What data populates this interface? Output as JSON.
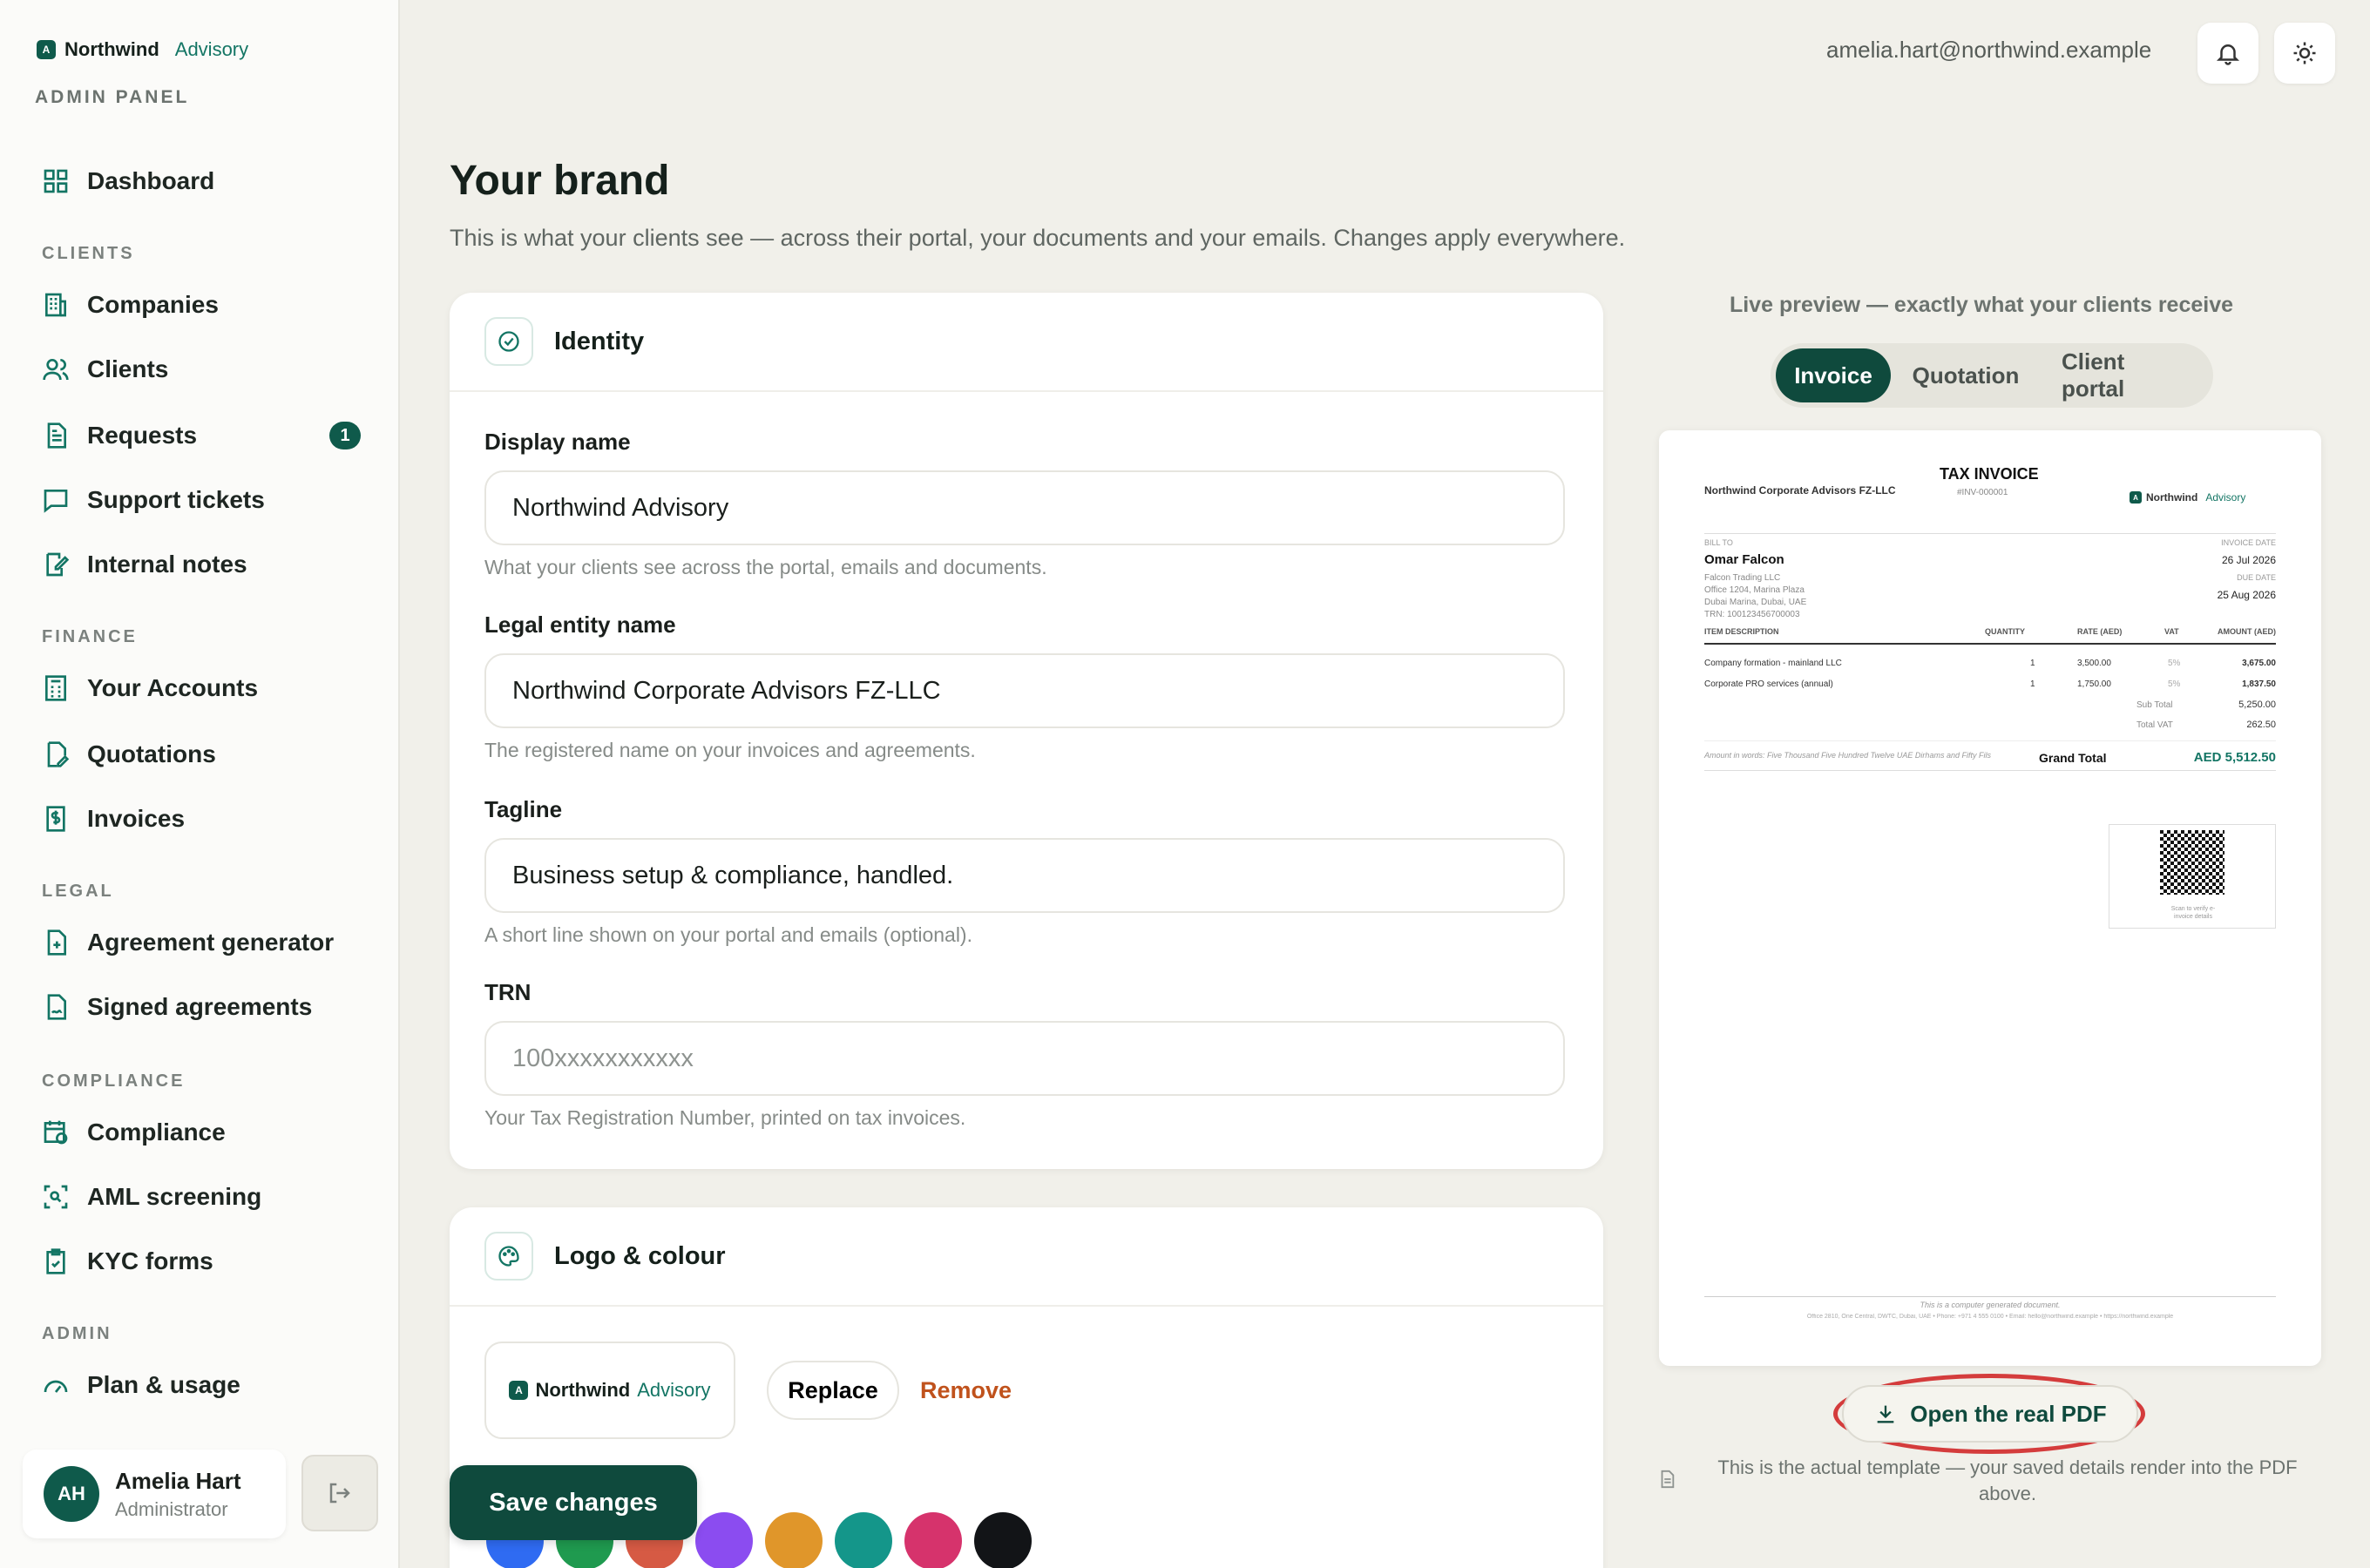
{
  "sidebar": {
    "brand_name": "Northwind",
    "brand_sub": "Advisory",
    "panel_label": "ADMIN PANEL",
    "sections": {
      "clients": "CLIENTS",
      "finance": "FINANCE",
      "legal": "LEGAL",
      "compliance": "COMPLIANCE",
      "admin": "ADMIN"
    },
    "items": {
      "dashboard": "Dashboard",
      "companies": "Companies",
      "clients": "Clients",
      "requests": "Requests",
      "requests_badge": "1",
      "support": "Support tickets",
      "notes": "Internal notes",
      "accounts": "Your Accounts",
      "quotations": "Quotations",
      "invoices": "Invoices",
      "agreement_gen": "Agreement generator",
      "signed": "Signed agreements",
      "compliance": "Compliance",
      "aml": "AML screening",
      "kyc": "KYC forms",
      "plan": "Plan & usage"
    },
    "user": {
      "initials": "AH",
      "name": "Amelia Hart",
      "role": "Administrator"
    }
  },
  "topbar": {
    "email": "amelia.hart@northwind.example"
  },
  "page": {
    "title": "Your brand",
    "subtitle": "This is what your clients see — across their portal, your documents and your emails. Changes apply everywhere."
  },
  "identity": {
    "title": "Identity",
    "display_name": {
      "label": "Display name",
      "value": "Northwind Advisory",
      "help": "What your clients see across the portal, emails and documents."
    },
    "legal_name": {
      "label": "Legal entity name",
      "value": "Northwind Corporate Advisors FZ-LLC",
      "help": "The registered name on your invoices and agreements."
    },
    "tagline": {
      "label": "Tagline",
      "value": "Business setup & compliance, handled.",
      "help": "A short line shown on your portal and emails (optional)."
    },
    "trn": {
      "label": "TRN",
      "value": "",
      "placeholder": "100xxxxxxxxxxx",
      "help": "Your Tax Registration Number, printed on tax invoices."
    }
  },
  "logo": {
    "title": "Logo & colour",
    "replace": "Replace",
    "remove": "Remove",
    "swatches": [
      "#2f6bf2",
      "#1f9a4f",
      "#d65a44",
      "#8b4cf0",
      "#e0962a",
      "#14968a",
      "#d6336c",
      "#121417"
    ]
  },
  "actions": {
    "save": "Save changes"
  },
  "preview": {
    "label": "Live preview — exactly what your clients receive",
    "tabs": [
      "Invoice",
      "Quotation",
      "Client portal"
    ],
    "open_pdf": "Open the real PDF",
    "note": "This is the actual template — your saved details render into the PDF above.",
    "doc": {
      "company": "Northwind Corporate Advisors FZ-LLC",
      "doc_title": "TAX INVOICE",
      "doc_number": "#INV-000001",
      "logo_name": "Northwind",
      "logo_sub": "Advisory",
      "bill_to_label": "BILL TO",
      "client_name": "Omar Falcon",
      "client_lines": [
        "Falcon Trading LLC",
        "Office 1204, Marina Plaza",
        "Dubai Marina, Dubai, UAE",
        "TRN: 100123456700003"
      ],
      "invoice_date_label": "INVOICE DATE",
      "invoice_date": "26 Jul 2026",
      "due_date_label": "DUE DATE",
      "due_date": "25 Aug 2026",
      "headers": [
        "ITEM DESCRIPTION",
        "QUANTITY",
        "RATE (AED)",
        "VAT",
        "AMOUNT (AED)"
      ],
      "rows": [
        [
          "Company formation - mainland LLC",
          "1",
          "3,500.00",
          "5%",
          "3,675.00"
        ],
        [
          "Corporate PRO services (annual)",
          "1",
          "1,750.00",
          "5%",
          "1,837.50"
        ]
      ],
      "subtotal_label": "Sub Total",
      "subtotal": "5,250.00",
      "vat_label": "Total VAT",
      "vat": "262.50",
      "words": "Amount in words: Five Thousand Five Hundred Twelve UAE Dirhams and Fifty Fils",
      "grand_label": "Grand Total",
      "grand": "AED 5,512.50",
      "qr_caption": "Scan to verify e-invoice details",
      "footer1": "This is a computer generated document.",
      "footer2": "Office 2810, One Central, DWTC, Dubai, UAE • Phone: +971 4 555 0100 • Email: hello@northwind.example • https://northwind.example"
    }
  }
}
